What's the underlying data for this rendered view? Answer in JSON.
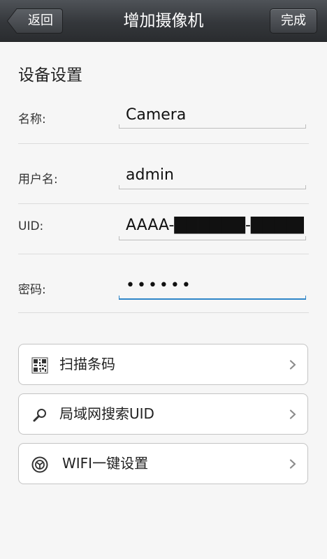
{
  "header": {
    "title": "增加摄像机",
    "back_label": "返回",
    "done_label": "完成"
  },
  "section_title": "设备设置",
  "fields": {
    "name": {
      "label": "名称:",
      "value": "Camera"
    },
    "username": {
      "label": "用户名:",
      "value": "admin"
    },
    "uid": {
      "label": "UID:",
      "value": "AAAA-██████-█████"
    },
    "password": {
      "label": "密码:",
      "value": "••••••"
    }
  },
  "actions": {
    "scan": {
      "label": "扫描条码",
      "icon": "qr-code-icon"
    },
    "lan_search": {
      "label": "局域网搜索UID",
      "icon": "search-icon"
    },
    "wifi_setup": {
      "label": "WIFI一键设置",
      "icon": "wifi-setup-icon"
    }
  },
  "colors": {
    "navbar": "#34373b",
    "active_field": "#2f86c8",
    "background": "#f6f6f6"
  }
}
